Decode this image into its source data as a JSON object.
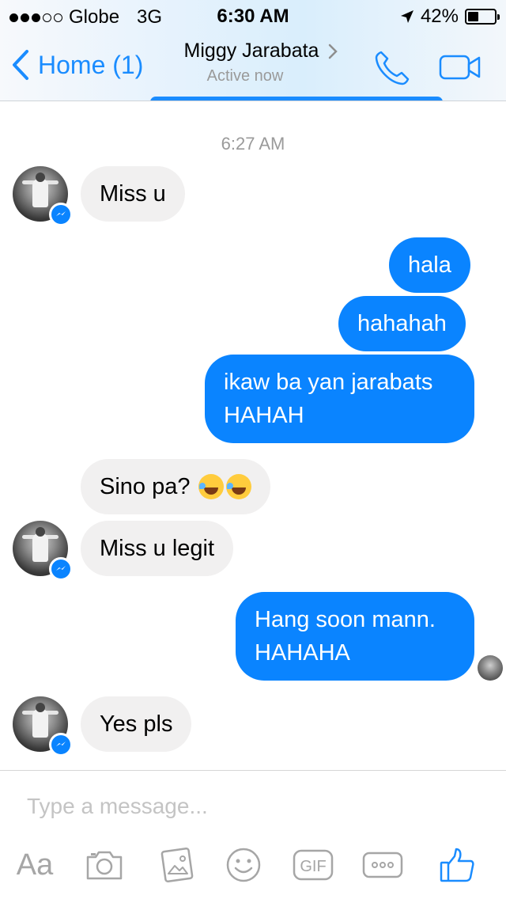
{
  "status_bar": {
    "carrier": "Globe",
    "network": "3G",
    "time": "6:30 AM",
    "battery": "42%",
    "battery_level": 0.42
  },
  "header": {
    "back_label": "Home (1)",
    "contact_name": "Miggy Jarabata",
    "presence": "Active now",
    "icons": [
      "back-chevron-icon",
      "chevron-right-icon",
      "phone-icon",
      "video-camera-icon"
    ],
    "accent_color": "#1a8cff"
  },
  "conversation": {
    "timestamp": "6:27 AM",
    "messages": [
      {
        "from": "contact",
        "text": "Miss u"
      },
      {
        "from": "me",
        "text": "hala"
      },
      {
        "from": "me",
        "text": "hahahah"
      },
      {
        "from": "me",
        "lines": [
          "ikaw ba yan jarabats",
          "HAHAH"
        ]
      },
      {
        "from": "contact",
        "text": "Sino pa?",
        "emoji": [
          "face-with-tears-of-joy",
          "face-with-tears-of-joy"
        ]
      },
      {
        "from": "contact",
        "text": "Miss u legit"
      },
      {
        "from": "me",
        "lines": [
          "Hang soon mann.",
          "HAHAHA"
        ]
      },
      {
        "from": "contact",
        "text": "Yes pls"
      }
    ],
    "colors": {
      "outgoing": "#0a84ff",
      "incoming": "#f1f0f0"
    }
  },
  "composer": {
    "placeholder": "Type a message...",
    "tools": {
      "text_format": "Aa",
      "gif": "GIF",
      "icons": [
        "camera-icon",
        "gallery-icon",
        "emoji-icon",
        "gif-icon",
        "more-icon",
        "thumbs-up-icon"
      ]
    }
  }
}
